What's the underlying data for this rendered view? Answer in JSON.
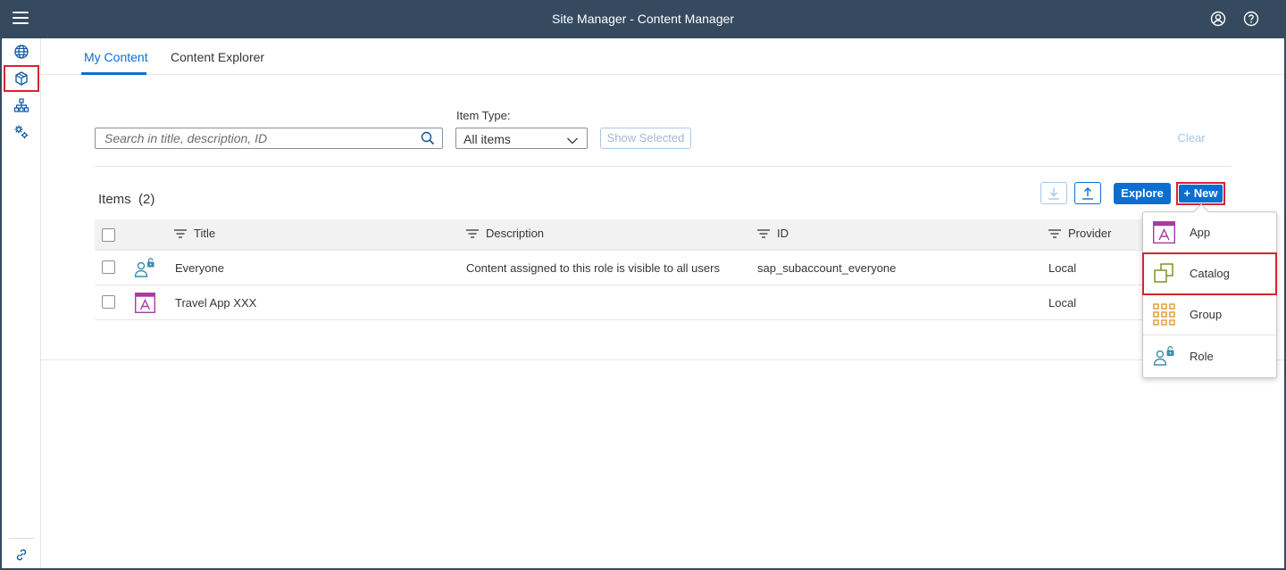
{
  "shell": {
    "title": "Site Manager - Content Manager"
  },
  "tabs": [
    {
      "label": "My Content",
      "active": true
    },
    {
      "label": "Content Explorer",
      "active": false
    }
  ],
  "filters": {
    "search_placeholder": "Search in title, description, ID",
    "item_type_label": "Item Type:",
    "item_type_value": "All items",
    "show_selected_label": "Show Selected",
    "clear_label": "Clear"
  },
  "items": {
    "title": "Items",
    "count": "(2)",
    "explore_label": "Explore",
    "new_label": "+ New"
  },
  "table": {
    "columns": [
      "Title",
      "Description",
      "ID",
      "Provider"
    ],
    "rows": [
      {
        "icon": "role-icon",
        "title": "Everyone",
        "description": "Content assigned to this role is visible to all users",
        "id": "sap_subaccount_everyone",
        "provider": "Local"
      },
      {
        "icon": "app-icon",
        "title": "Travel App XXX",
        "description": "",
        "id": "",
        "provider": "Local"
      }
    ]
  },
  "new_menu": [
    {
      "label": "App",
      "icon": "app-icon"
    },
    {
      "label": "Catalog",
      "icon": "catalog-icon"
    },
    {
      "label": "Group",
      "icon": "group-icon"
    },
    {
      "label": "Role",
      "icon": "role-icon"
    }
  ],
  "colors": {
    "shellbar": "#354a5f",
    "accent": "#0a6ed1",
    "highlight": "#d6262f",
    "app_purple": "#a63da3",
    "catalog_green": "#6f8d1e",
    "group_orange": "#e09a2c",
    "role_teal": "#3c8cb0"
  }
}
